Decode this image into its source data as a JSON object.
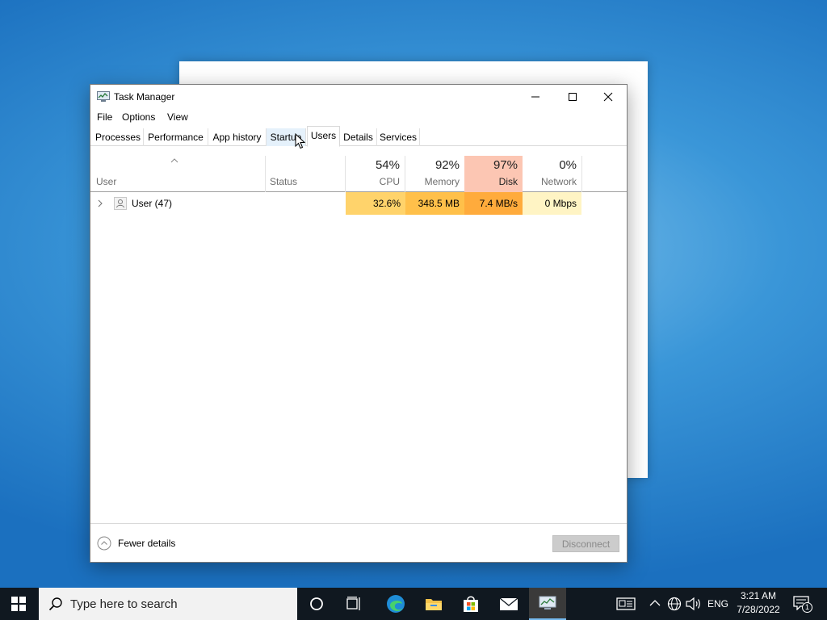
{
  "window": {
    "title": "Task Manager",
    "controls": {
      "minimize": "minimize-icon",
      "maximize": "maximize-icon",
      "close": "close-icon"
    }
  },
  "menu": [
    "File",
    "Options",
    "View"
  ],
  "tabs": [
    "Processes",
    "Performance",
    "App history",
    "Startup",
    "Users",
    "Details",
    "Services"
  ],
  "active_tab": "Users",
  "columns": {
    "user": "User",
    "status": "Status",
    "cpu": {
      "percent": "54%",
      "label": "CPU"
    },
    "memory": {
      "percent": "92%",
      "label": "Memory"
    },
    "disk": {
      "percent": "97%",
      "label": "Disk"
    },
    "network": {
      "percent": "0%",
      "label": "Network"
    }
  },
  "rows": [
    {
      "user": "User (47)",
      "status": "",
      "cpu": "32.6%",
      "memory": "348.5 MB",
      "disk": "7.4 MB/s",
      "network": "0 Mbps"
    }
  ],
  "footer": {
    "fewer_details": "Fewer details",
    "disconnect": "Disconnect"
  },
  "taskbar": {
    "search_placeholder": "Type here to search",
    "tray": {
      "language": "ENG",
      "time": "3:21 AM",
      "date": "7/28/2022",
      "notification_count": "1"
    }
  },
  "colors": {
    "cpu_cell": "#ffd36b",
    "memory_cell": "#ffc04a",
    "disk_cell": "#ffab3c",
    "disk_header": "#fcc6b3",
    "network_cell": "#fff4c4",
    "taskbar": "#101820",
    "edge_active": "#3a3a3a"
  }
}
